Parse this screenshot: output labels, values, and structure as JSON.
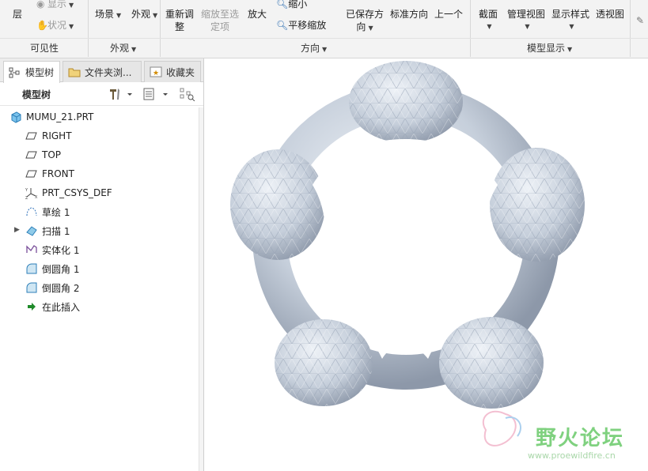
{
  "ribbon": {
    "layer": "层",
    "show": "显示",
    "status": "状况",
    "scene": "场景",
    "appearance": "外观",
    "refit_line1": "重新调",
    "refit_line2": "整",
    "zoom_sel_line1": "缩放至选",
    "zoom_sel_line2": "定项",
    "zoom_in": "放大",
    "zoom_out": "缩小",
    "pan_zoom": "平移缩放",
    "saved_line1": "已保存方",
    "saved_line2": "向",
    "std_orient": "标准方向",
    "prev": "上一个",
    "section": "截面",
    "manage_views": "管理视图",
    "display_style": "显示样式",
    "perspective": "透视图",
    "groups": {
      "visibility": "可见性",
      "appearance": "外观",
      "orientation": "方向",
      "model_display": "模型显示"
    }
  },
  "panel": {
    "tabs": [
      "模型树",
      "文件夹浏...",
      "收藏夹"
    ],
    "toolbar_title": "模型树",
    "tree": [
      {
        "label": "MUMU_21.PRT",
        "icon": "part-icon"
      },
      {
        "label": "RIGHT",
        "icon": "datum-plane-icon"
      },
      {
        "label": "TOP",
        "icon": "datum-plane-icon"
      },
      {
        "label": "FRONT",
        "icon": "datum-plane-icon"
      },
      {
        "label": "PRT_CSYS_DEF",
        "icon": "csys-icon"
      },
      {
        "label": "草绘 1",
        "icon": "sketch-icon"
      },
      {
        "label": "扫描 1",
        "icon": "sweep-icon"
      },
      {
        "label": "实体化 1",
        "icon": "solidify-icon"
      },
      {
        "label": "倒圆角 1",
        "icon": "round-icon"
      },
      {
        "label": "倒圆角 2",
        "icon": "round-icon"
      },
      {
        "label": "在此插入",
        "icon": "insert-here-icon"
      }
    ]
  },
  "watermark": {
    "brand": "野火论坛",
    "url": "www.proewildfire.cn"
  },
  "colors": {
    "model": "#c9d1dc",
    "watermark": "#7fd17f",
    "accent": "#2e8ad6"
  }
}
